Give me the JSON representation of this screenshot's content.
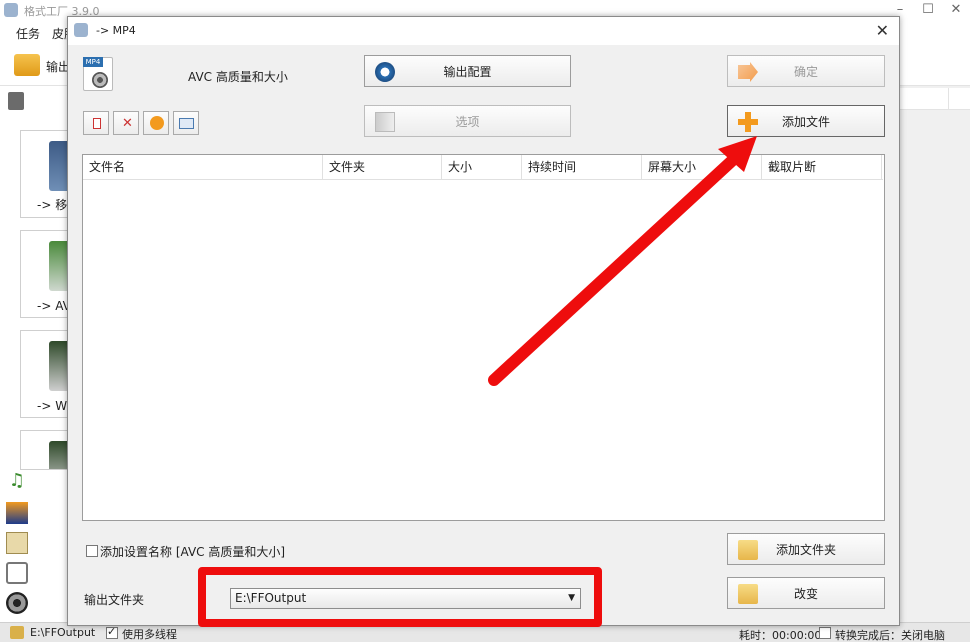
{
  "app": {
    "title": "格式工厂 3.9.0",
    "menu": [
      "任务",
      "皮肤"
    ],
    "toolbar_label": "输出",
    "left_cards": [
      "-> 移动",
      "-> AV",
      "-> WM",
      ""
    ]
  },
  "dialog": {
    "title": "-> MP4",
    "preset": "AVC 高质量和大小",
    "buttons": {
      "output_config": "输出配置",
      "options": "选项",
      "ok": "确定",
      "add_file": "添加文件",
      "add_folder": "添加文件夹",
      "change": "改变"
    },
    "columns": [
      "文件名",
      "文件夹",
      "大小",
      "持续时间",
      "屏幕大小",
      "截取片断"
    ],
    "add_name_checkbox": "添加设置名称 [AVC 高质量和大小]",
    "output_folder_label": "输出文件夹",
    "output_folder_value": "E:\\FFOutput"
  },
  "status": {
    "path": "E:\\FFOutput",
    "multithread": "使用多线程",
    "elapsed": "耗时：00:00:00",
    "after_convert": "转换完成后：关闭电脑"
  },
  "colors": {
    "annotation": "#ee0d0d"
  }
}
